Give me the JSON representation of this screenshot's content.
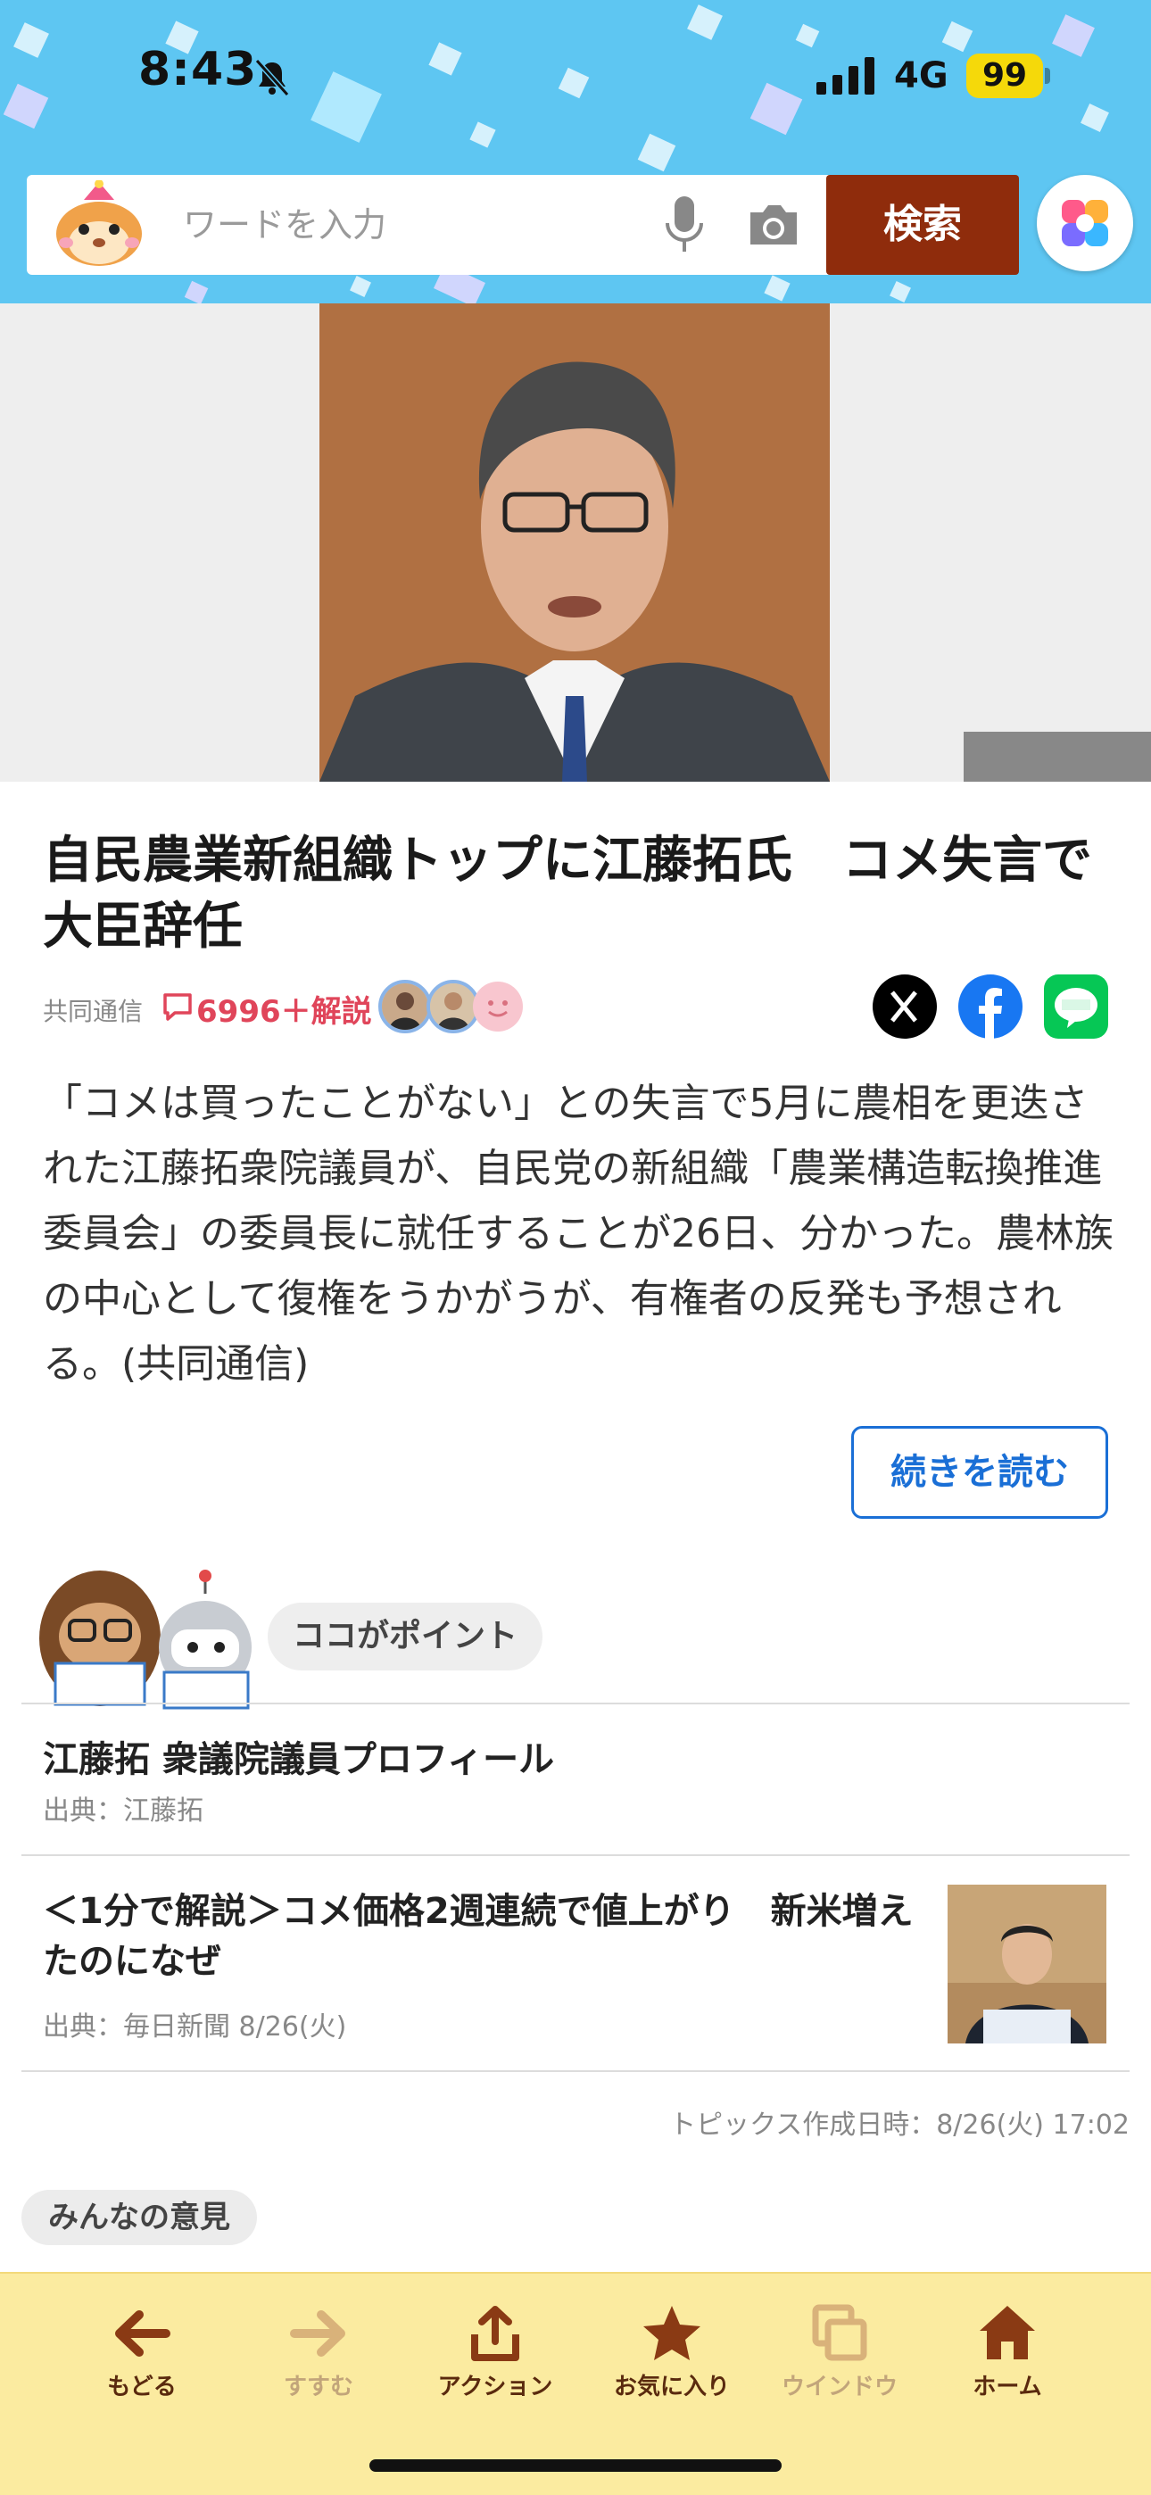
{
  "status_bar": {
    "time": "8:43",
    "network": "4G",
    "battery": "99"
  },
  "search": {
    "placeholder": "ワードを入力",
    "button_label": "検索"
  },
  "article": {
    "title": "自民農業新組織トップに江藤拓氏　コメ失言で大臣辞任",
    "source": "共同通信",
    "comment_count": "6996＋解説",
    "body": "「コメは買ったことがない」との失言で5月に農相を更迭された江藤拓衆院議員が、自民党の新組織「農業構造転換推進委員会」の委員長に就任することが26日、分かった。農林族の中心として復権をうかがうが、有権者の反発も予想される。(共同通信)",
    "read_more": "続きを読む"
  },
  "point_section": {
    "label": "ココがポイント",
    "items": [
      {
        "title": "江藤拓 衆議院議員プロフィール",
        "source": "出典：江藤拓"
      },
      {
        "title": "＜1分で解説＞コメ価格2週連続で値上がり　新米増えたのになぜ",
        "source": "出典：毎日新聞 8/26(火)"
      }
    ],
    "created": "トピックス作成日時：8/26(火) 17:02"
  },
  "opinion_label": "みんなの意見",
  "toolbar": {
    "back": "もどる",
    "forward": "すすむ",
    "action": "アクション",
    "favorite": "お気に入り",
    "window": "ウインドウ",
    "home": "ホーム"
  },
  "colors": {
    "header_bg": "#5ec6f2",
    "search_button": "#8f2c0c",
    "comment_accent": "#e0455a",
    "link_blue": "#1a6fd6",
    "toolbar_bg": "#fbeba0",
    "toolbar_active": "#5a2a0e",
    "toolbar_inactive": "#c2a57a"
  },
  "icons": [
    "bell-slash-icon",
    "signal-icon",
    "mascot-icon",
    "mic-icon",
    "camera-icon",
    "ai-assistant-icon",
    "comment-icon",
    "x-icon",
    "facebook-icon",
    "line-icon",
    "back-arrow-icon",
    "forward-arrow-icon",
    "share-icon",
    "star-icon",
    "window-icon",
    "home-icon"
  ]
}
